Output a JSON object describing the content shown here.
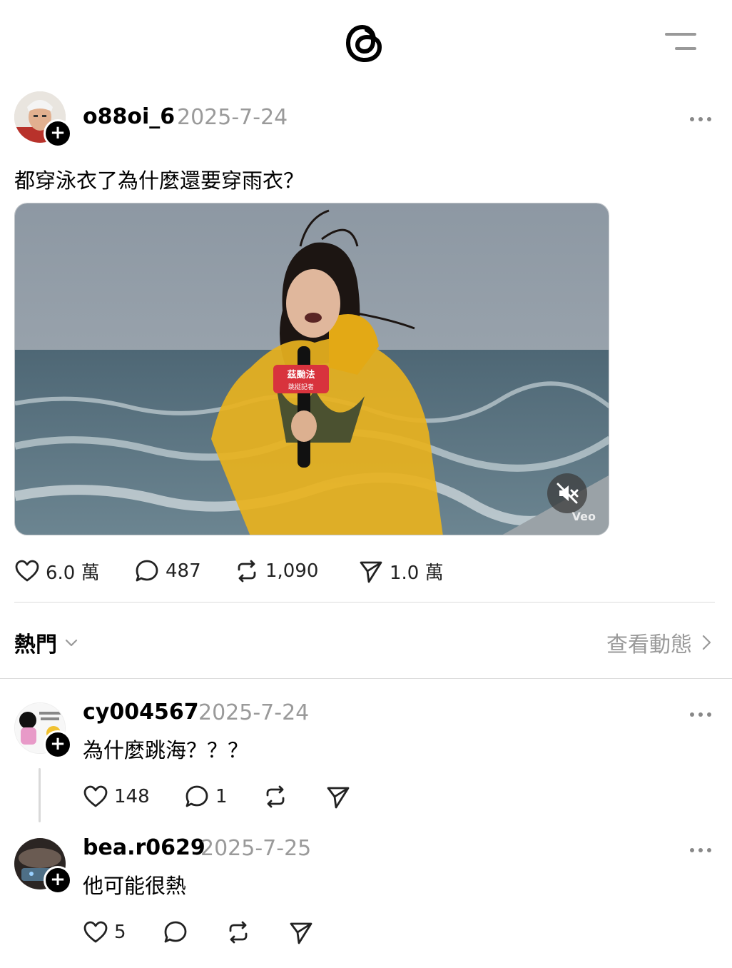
{
  "header": {
    "logo_icon": "threads-logo-icon",
    "menu_icon": "menu-icon"
  },
  "post": {
    "username": "o88oi_6",
    "date": "2025-7-24",
    "text": "都穿泳衣了為什麼還要穿雨衣？",
    "media": {
      "mic_label_top": "茲颱法",
      "mic_label_bottom": "跳挺記者",
      "watermark": "Veo",
      "mute_icon": "volume-muted-icon"
    },
    "actions": {
      "likes": "6.0 萬",
      "comments": "487",
      "reposts": "1,090",
      "shares": "1.0 萬"
    }
  },
  "replies_header": {
    "sort_label": "熱門",
    "view_activity": "查看動態"
  },
  "replies": [
    {
      "username": "cy004567",
      "date": "2025-7-24",
      "text": "為什麼跳海？？？",
      "likes": "148",
      "comments": "1"
    },
    {
      "username": "bea.r0629",
      "date": "2025-7-25",
      "text": "他可能很熱",
      "likes": "5",
      "comments": ""
    }
  ],
  "colors": {
    "text": "#000000",
    "muted": "#9a9a9a",
    "divider": "#dcdcdc",
    "raincoat": "#e8b21e"
  }
}
